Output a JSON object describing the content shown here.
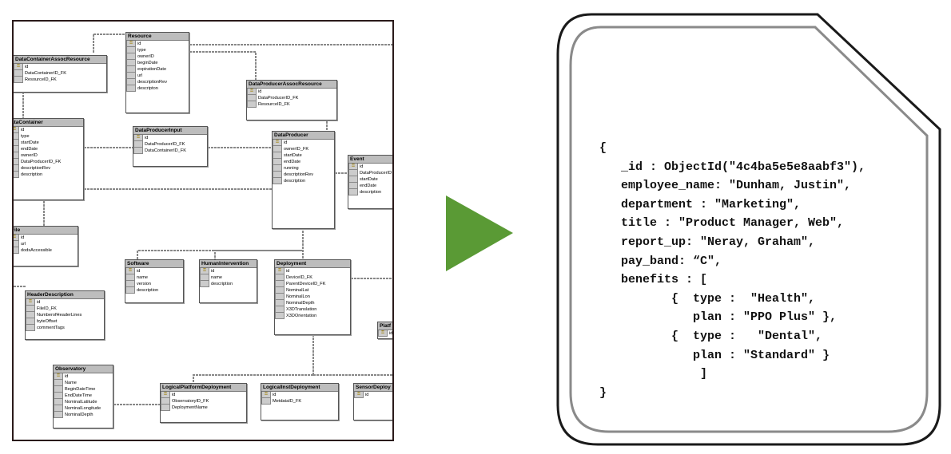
{
  "er_diagram": {
    "tables": [
      {
        "name": "Resource",
        "fields": [
          "id",
          "type",
          "ownerID",
          "beginDate",
          "expirationDate",
          "url",
          "descriptionRev",
          "descripton"
        ]
      },
      {
        "name": "DataContainerAssocResource",
        "display": "aContainerAssocResource",
        "fields": [
          "id",
          "DataContainerID_FK",
          "ResourceID_FK"
        ]
      },
      {
        "name": "DataProducerAssocResource",
        "fields": [
          "id",
          "DataProducerID_FK",
          "ResourceID_FK"
        ]
      },
      {
        "name": "DataContainer",
        "display": "ataContainer",
        "fields": [
          "id",
          "type",
          "startDate",
          "endDate",
          "ownerID",
          "DataProducerID_FK",
          "descriptionRev",
          "description"
        ]
      },
      {
        "name": "DataProducerInput",
        "fields": [
          "id",
          "DataProducerID_FK",
          "DataContainerID_FK"
        ]
      },
      {
        "name": "DataProducer",
        "fields": [
          "id",
          "ownerID_FK",
          "startDate",
          "endDate",
          "running",
          "descriptionRev",
          "description"
        ]
      },
      {
        "name": "Event",
        "fields": [
          "id",
          "DataProducerID",
          "startDate",
          "endDate",
          "description"
        ]
      },
      {
        "name": "File",
        "fields": [
          "id",
          "url",
          "dodsAccessible"
        ]
      },
      {
        "name": "Software",
        "fields": [
          "id",
          "name",
          "version",
          "description"
        ]
      },
      {
        "name": "HumanIntervention",
        "fields": [
          "id",
          "name",
          "description"
        ]
      },
      {
        "name": "Deployment",
        "fields": [
          "id",
          "DeviceID_FK",
          "ParentDeviceID_FK",
          "NominalLat",
          "NominalLon",
          "NominalDepth",
          "X3DTranslation",
          "X3DOrientation"
        ]
      },
      {
        "name": "HeaderDescription",
        "fields": [
          "id",
          "FileID_FK",
          "NumberofHeaderLines",
          "byteOffset",
          "commentTags"
        ]
      },
      {
        "name": "Platf",
        "fields": [
          "id"
        ]
      },
      {
        "name": "Observatory",
        "fields": [
          "id",
          "Name",
          "BeginDateTime",
          "EndDateTime",
          "NominalLatitude",
          "NominalLongitude",
          "NominalDepth"
        ]
      },
      {
        "name": "LogicalPlatformDeployment",
        "fields": [
          "id",
          "ObservatoryID_FK",
          "DeploymentName"
        ]
      },
      {
        "name": "LogicalInstDeployment",
        "fields": [
          "id",
          "MetdataID_FK"
        ]
      },
      {
        "name": "SensorDeploy",
        "fields": [
          "id"
        ]
      }
    ]
  },
  "arrow_color": "#5a9a35",
  "document": {
    "lines": [
      "{",
      "   _id : ObjectId(\"4c4ba5e5e8aabf3\"),",
      "   employee_name: \"Dunham, Justin\",",
      "   department : \"Marketing\",",
      "   title : \"Product Manager, Web\",",
      "   report_up: \"Neray, Graham\",",
      "   pay_band: “C\",",
      "   benefits : [",
      "          {  type :  \"Health\",",
      "             plan : \"PPO Plus\" },",
      "          {  type :   \"Dental\",",
      "             plan : \"Standard\" }",
      "              ]",
      "}"
    ]
  }
}
